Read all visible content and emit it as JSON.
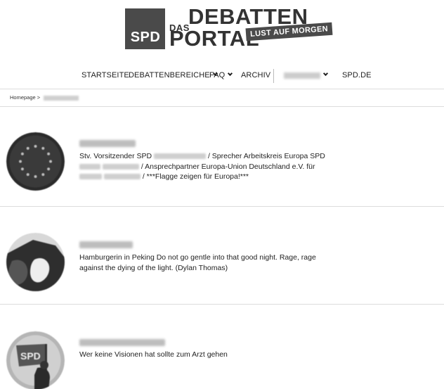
{
  "logo": {
    "box_text": "SPD",
    "das": "DAS",
    "debatten": "DEBATTEN",
    "portal": "PORTAL",
    "tagline": "LUST AUF MORGEN"
  },
  "nav": {
    "startseite": "STARTSEITE",
    "debattenbereiche": "DEBATTENBEREICHE",
    "faq": "FAQ",
    "archiv": "ARCHIV",
    "spd_de": "SPD.DE"
  },
  "breadcrumb": {
    "home": "Homepage",
    "separator": ">"
  },
  "profiles": [
    {
      "bio_parts": {
        "a": "Stv. Vorsitzender SPD",
        "b": "/ Sprecher Arbeitskreis Europa SPD",
        "c": "/ Ansprechpartner Europa-Union Deutschland e.V. für",
        "d": "/ ***Flagge zeigen für Europa!***"
      }
    },
    {
      "bio": "Hamburgerin in Peking Do not go gentle into that good night. Rage, rage against the dying of the light. (Dylan Thomas)"
    },
    {
      "bio": "Wer keine Visionen hat sollte zum Arzt gehen"
    }
  ],
  "colors": {
    "logo_gray": "#4a4a4a",
    "divider": "#dcdcdc",
    "text": "#222222"
  },
  "icons": {
    "dropdown": "chevron-down-icon"
  }
}
